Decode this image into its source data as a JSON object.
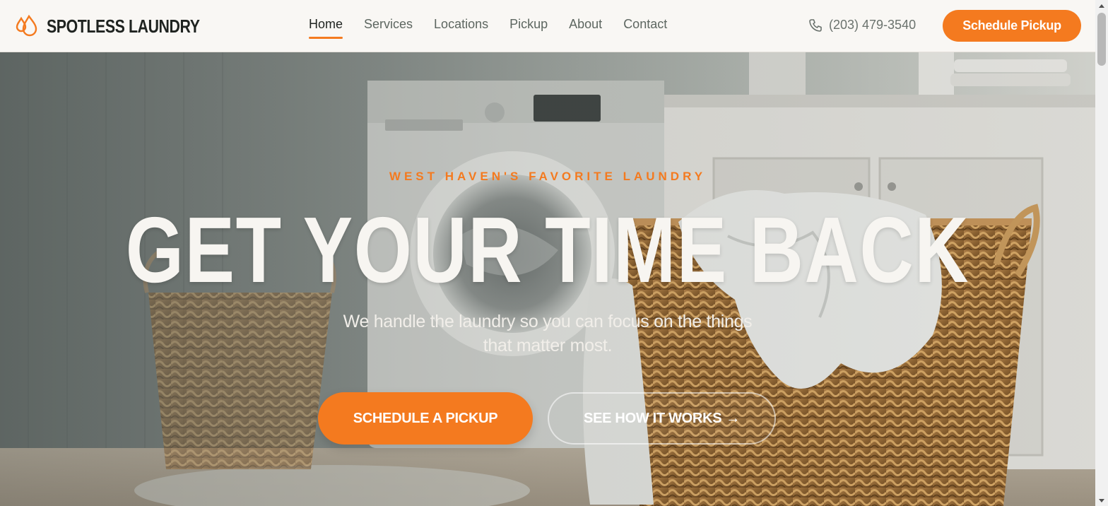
{
  "brand": {
    "name": "SPOTLESS LAUNDRY",
    "logo_icon": "droplets-icon",
    "accent": "#f47a1f"
  },
  "nav": {
    "items": [
      {
        "label": "Home",
        "active": true
      },
      {
        "label": "Services",
        "active": false
      },
      {
        "label": "Locations",
        "active": false
      },
      {
        "label": "Pickup",
        "active": false
      },
      {
        "label": "About",
        "active": false
      },
      {
        "label": "Contact",
        "active": false
      }
    ]
  },
  "header": {
    "phone": "(203) 479-3540",
    "phone_icon": "phone-icon",
    "cta_label": "Schedule Pickup"
  },
  "hero": {
    "eyebrow": "WEST HAVEN'S FAVORITE LAUNDRY",
    "headline": "GET YOUR TIME BACK",
    "subhead": "We handle the laundry so you can focus on the things that matter most.",
    "primary_cta": "SCHEDULE A PICKUP",
    "secondary_cta": "SEE HOW IT WORKS",
    "secondary_icon": "arrow-right-icon",
    "background": "laundry-room-with-washer-and-wicker-basket"
  }
}
